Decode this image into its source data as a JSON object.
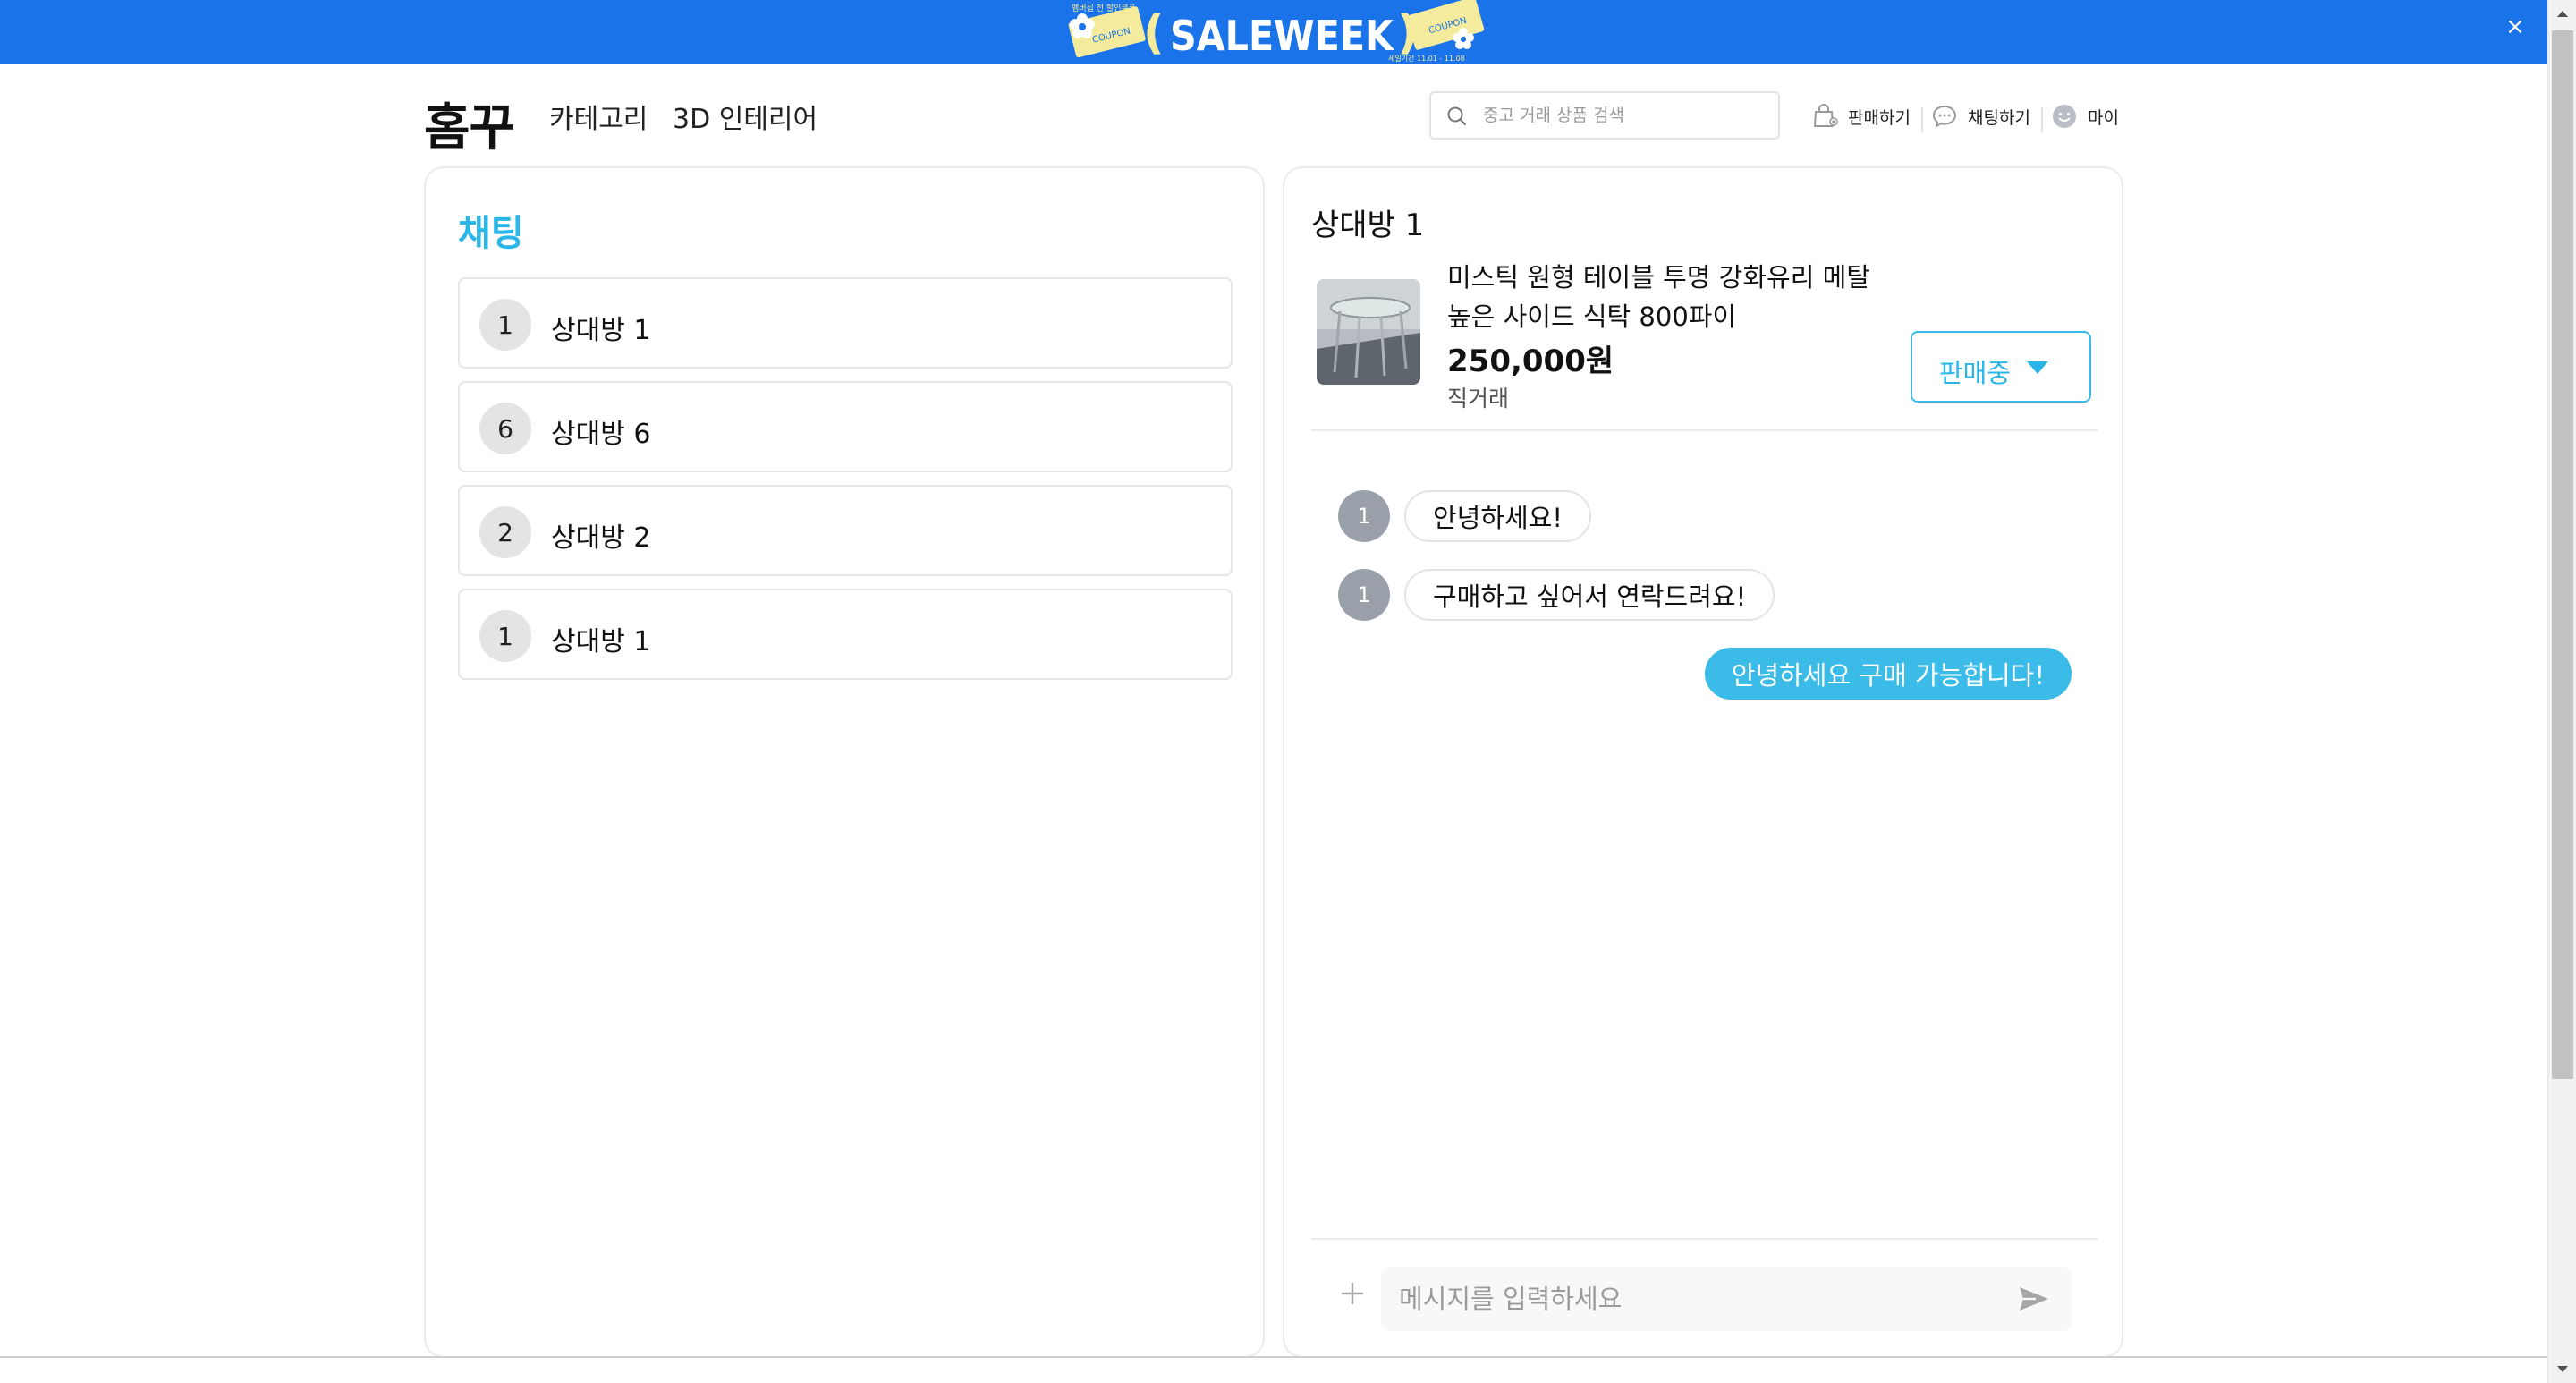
{
  "banner": {
    "brand": "SALEWEEK",
    "top_text": "멤버십 전 할인쿠폰",
    "coupon_text": "COUPON",
    "date_text": "세일기간 11.01 - 11.08",
    "close_label": "×",
    "background_color": "#1a73e8",
    "accent_color": "#f4ec9c"
  },
  "header": {
    "logo": "홈꾸",
    "nav": [
      "카테고리",
      "3D 인테리어"
    ],
    "search_placeholder": "중고 거래 상품 검색",
    "search_icon": "search-icon",
    "utilities": [
      {
        "label": "판매하기",
        "icon": "shopping-bag-icon"
      },
      {
        "label": "채팅하기",
        "icon": "chat-bubble-icon"
      },
      {
        "label": "마이",
        "icon": "smiley-icon"
      }
    ]
  },
  "chat_list": {
    "title": "채팅",
    "rooms": [
      {
        "avatar": "1",
        "name": "상대방 1"
      },
      {
        "avatar": "6",
        "name": "상대방 6"
      },
      {
        "avatar": "2",
        "name": "상대방 2"
      },
      {
        "avatar": "1",
        "name": "상대방 1"
      }
    ]
  },
  "chat_room": {
    "title": "상대방 1",
    "product": {
      "title_line1": "미스틱 원형 테이블 투명 강화유리 메탈",
      "title_line2": "높은 사이드 식탁 800파이",
      "price": "250,000원",
      "method": "직거래",
      "status": "판매중",
      "image": "round-glass-table-photo"
    },
    "messages": [
      {
        "from": "other",
        "avatar": "1",
        "text": "안녕하세요!"
      },
      {
        "from": "other",
        "avatar": "1",
        "text": "구매하고 싶어서 연락드려요!"
      },
      {
        "from": "me",
        "text": "안녕하세요 구매 가능합니다!"
      }
    ],
    "composer": {
      "placeholder": "메시지를 입력하세요",
      "plus_icon": "plus-icon",
      "send_icon": "send-icon"
    }
  },
  "colors": {
    "accent": "#29b6e8",
    "my_bubble": "#3bbbe8",
    "other_avatar": "#9aa0aa"
  }
}
